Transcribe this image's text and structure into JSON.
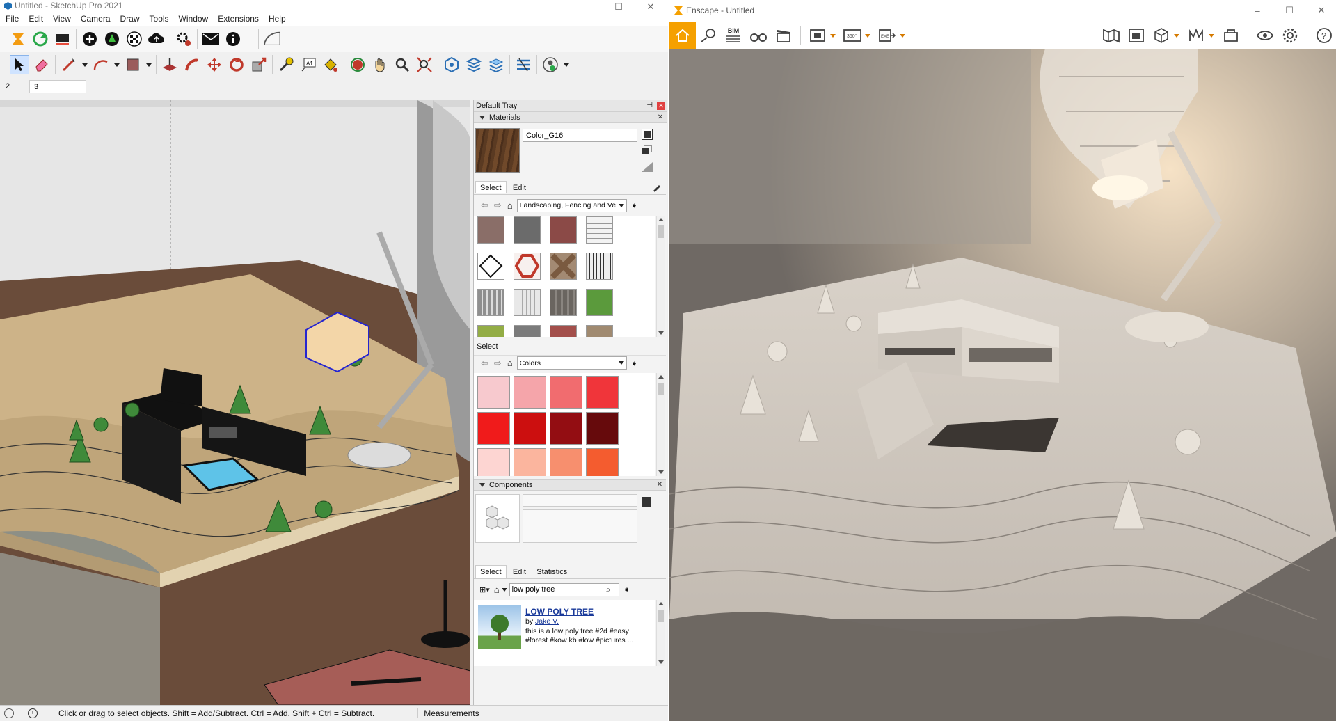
{
  "sketchup": {
    "title": "Untitled - SketchUp Pro 2021",
    "menu": [
      "File",
      "Edit",
      "View",
      "Camera",
      "Draw",
      "Tools",
      "Window",
      "Extensions",
      "Help"
    ],
    "measure_left": "2",
    "measure_right": "3",
    "status_text": "Click or drag to select objects. Shift = Add/Subtract. Ctrl = Add. Shift + Ctrl = Subtract.",
    "measurements_label": "Measurements"
  },
  "tray": {
    "title": "Default Tray",
    "materials": {
      "header": "Materials",
      "name_value": "Color_G16",
      "tab_select": "Select",
      "tab_edit": "Edit",
      "library_value": "Landscaping, Fencing and Ve",
      "select_label": "Select",
      "colors_library_value": "Colors",
      "texture_swatches": [
        "#8a6e68",
        "#6b6b6b",
        "#8b4a47",
        "#f3f3f3",
        "#ffffff",
        "#f7f0ee",
        "#a38a73",
        "#eeeeee",
        "#8f8f8f",
        "#e8e8e8",
        "#6a6560",
        "#5b9a3c",
        "#93ad45",
        "#7b7b7b",
        "#a34f4b",
        "#a08a70",
        "#9a6e62",
        "#b29a80",
        "#888888",
        "#8e7a72"
      ],
      "color_swatches": [
        "#f7c9ce",
        "#f5a5aa",
        "#f16c6f",
        "#f0353a",
        "#f01b1b",
        "#cc0f0f",
        "#930d12",
        "#660a0c",
        "#fdd5d2",
        "#fbb59e",
        "#f78f6e",
        "#f45c2f"
      ]
    },
    "components": {
      "header": "Components",
      "tab_select": "Select",
      "tab_edit": "Edit",
      "tab_statistics": "Statistics",
      "search_value": "low poly tree",
      "result_title": "LOW POLY TREE",
      "result_by": "by",
      "result_author": "Jake V.",
      "result_desc_1": "this is a low poly tree #2d #easy",
      "result_desc_2": "#forest #kow  kb #low #pictures ..."
    }
  },
  "enscape": {
    "title": "Enscape - Untitled",
    "bim_label": "BIM",
    "accent": "#f5a000"
  }
}
